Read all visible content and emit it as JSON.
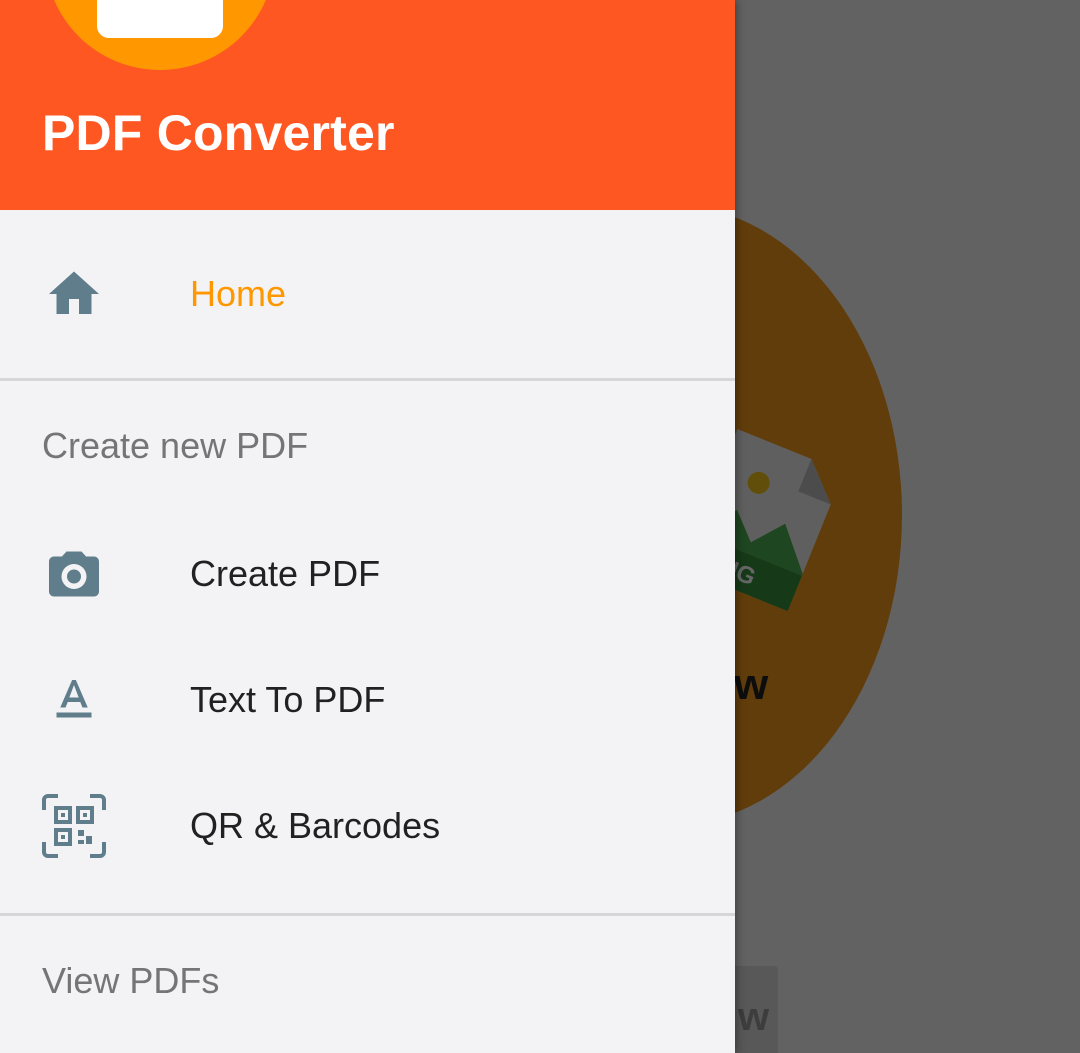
{
  "app": {
    "title": "PDF Converter"
  },
  "nav": {
    "home": {
      "label": "Home",
      "icon": "home-icon",
      "active": true
    },
    "sections": [
      {
        "header": "Create new PDF",
        "items": [
          {
            "label": "Create PDF",
            "icon": "camera-icon"
          },
          {
            "label": "Text To PDF",
            "icon": "text-format-icon"
          },
          {
            "label": "QR & Barcodes",
            "icon": "qr-code-scan-icon"
          }
        ]
      },
      {
        "header": "View PDFs",
        "items": []
      }
    ]
  },
  "background": {
    "visible_label": "w",
    "button_label": "w"
  },
  "colors": {
    "header": "#ff5722",
    "logo": "#ff9800",
    "active": "#ff9800",
    "icon": "#607d8b",
    "drawer_bg": "#f3f3f5"
  }
}
